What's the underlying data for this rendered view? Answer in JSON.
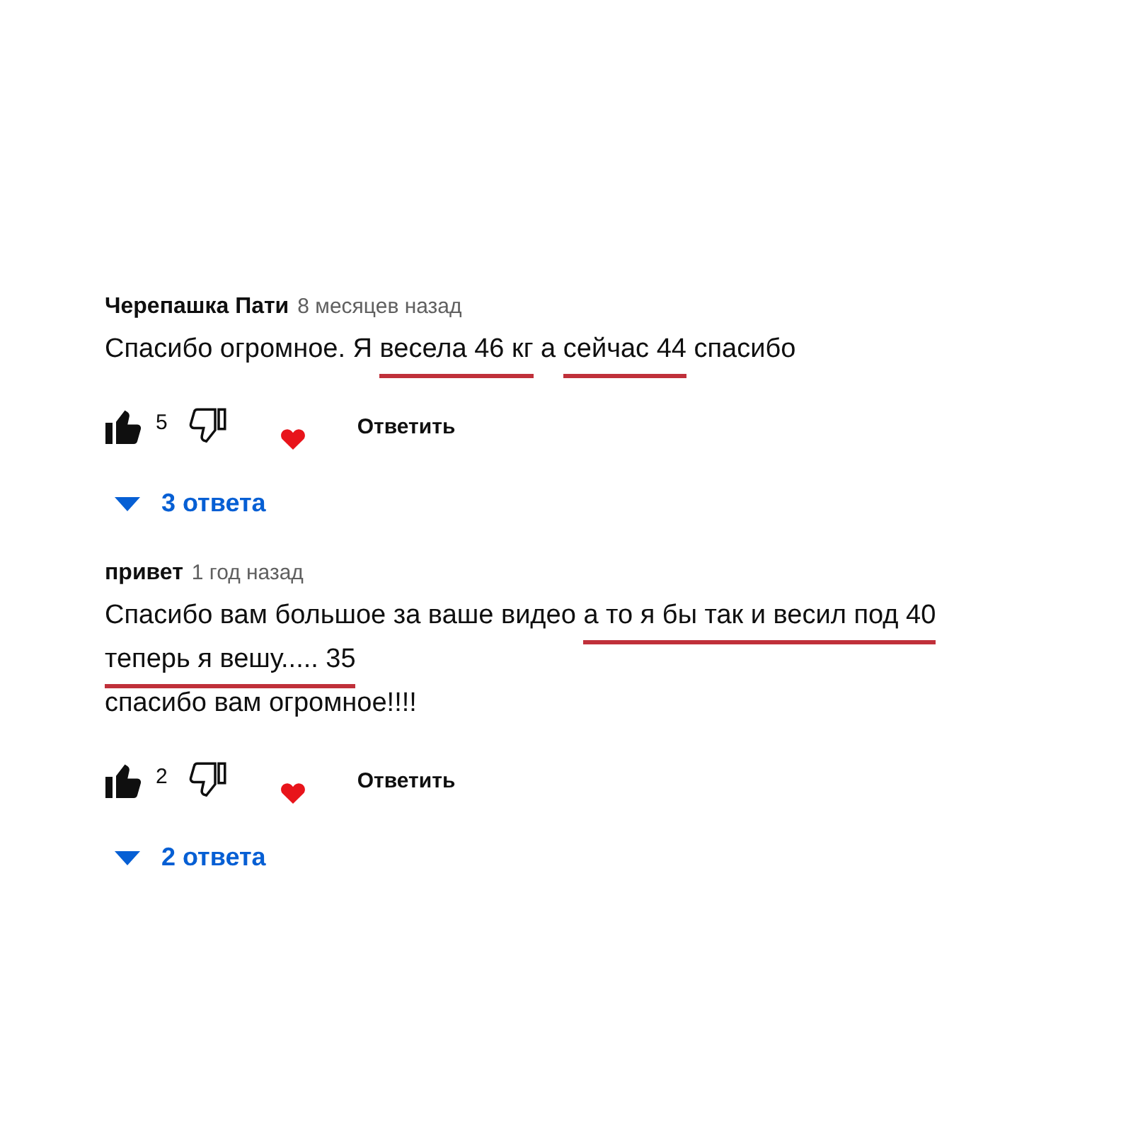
{
  "comments": [
    {
      "author": "Черепашка Пати",
      "time": "8 месяцев назад",
      "lines": [
        [
          {
            "text": "Спасибо огромное. Я ",
            "underlined": false
          },
          {
            "text": "весела 46 кг",
            "underlined": true
          },
          {
            "text": " а ",
            "underlined": false
          },
          {
            "text": "сейчас 44",
            "underlined": true
          },
          {
            "text": " спасибо",
            "underlined": false
          }
        ]
      ],
      "likes": "5",
      "liked": true,
      "hearted": true,
      "reply_label": "Ответить",
      "replies": "3 ответа"
    },
    {
      "author": "привет",
      "time": "1 год назад",
      "lines": [
        [
          {
            "text": "Спасибо вам большое за ваше видео ",
            "underlined": false
          },
          {
            "text": "а то я бы так и весил под 40",
            "underlined": true
          }
        ],
        [
          {
            "text": "теперь я вешу..... 35",
            "underlined": true
          }
        ],
        [
          {
            "text": "спасибо вам огромное!!!!",
            "underlined": false
          }
        ]
      ],
      "likes": "2",
      "liked": true,
      "hearted": true,
      "reply_label": "Ответить",
      "replies": "2 ответа"
    }
  ]
}
